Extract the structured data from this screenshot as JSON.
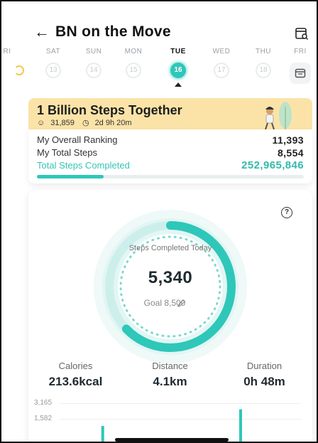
{
  "header": {
    "title": "BN on the Move",
    "back_icon": "arrow-left-icon",
    "calendar_icon": "calendar-search-icon"
  },
  "week": {
    "days": [
      {
        "name": "RI",
        "date": ""
      },
      {
        "name": "SAT",
        "date": "13"
      },
      {
        "name": "SUN",
        "date": "14"
      },
      {
        "name": "MON",
        "date": "15"
      },
      {
        "name": "TUE",
        "date": "16"
      },
      {
        "name": "WED",
        "date": "17"
      },
      {
        "name": "THU",
        "date": "18"
      },
      {
        "name": "FRI",
        "date": ""
      }
    ],
    "selected": "TUE",
    "accent_color": "#2ec7b9"
  },
  "challenge": {
    "title": "1 Billion Steps Together",
    "participants": "31,859",
    "time_left": "2d 9h 20m",
    "background_color": "#fbe3a8"
  },
  "stats": {
    "ranking_label": "My Overall Ranking",
    "ranking_value": "11,393",
    "steps_label": "My Total Steps",
    "steps_value": "8,554",
    "total_label": "Total Steps Completed",
    "total_value": "252,965,846",
    "progress_fraction": 0.25
  },
  "activity": {
    "steps_label": "Steps Completed Today",
    "steps_value": "5,340",
    "goal_label": "Goal 8,500",
    "goal_progress": 0.628,
    "metrics": [
      {
        "label": "Calories",
        "value": "213.6kcal"
      },
      {
        "label": "Distance",
        "value": "4.1km"
      },
      {
        "label": "Duration",
        "value": "0h 48m"
      }
    ]
  },
  "chart_data": {
    "type": "bar",
    "yticks": [
      "3,165",
      "1,582"
    ],
    "ylim": [
      0,
      3165
    ],
    "values": [
      0,
      0,
      1420,
      0,
      120,
      0,
      110,
      0,
      80,
      0,
      2700,
      90,
      0,
      0
    ],
    "color": "#2ec7b9"
  }
}
